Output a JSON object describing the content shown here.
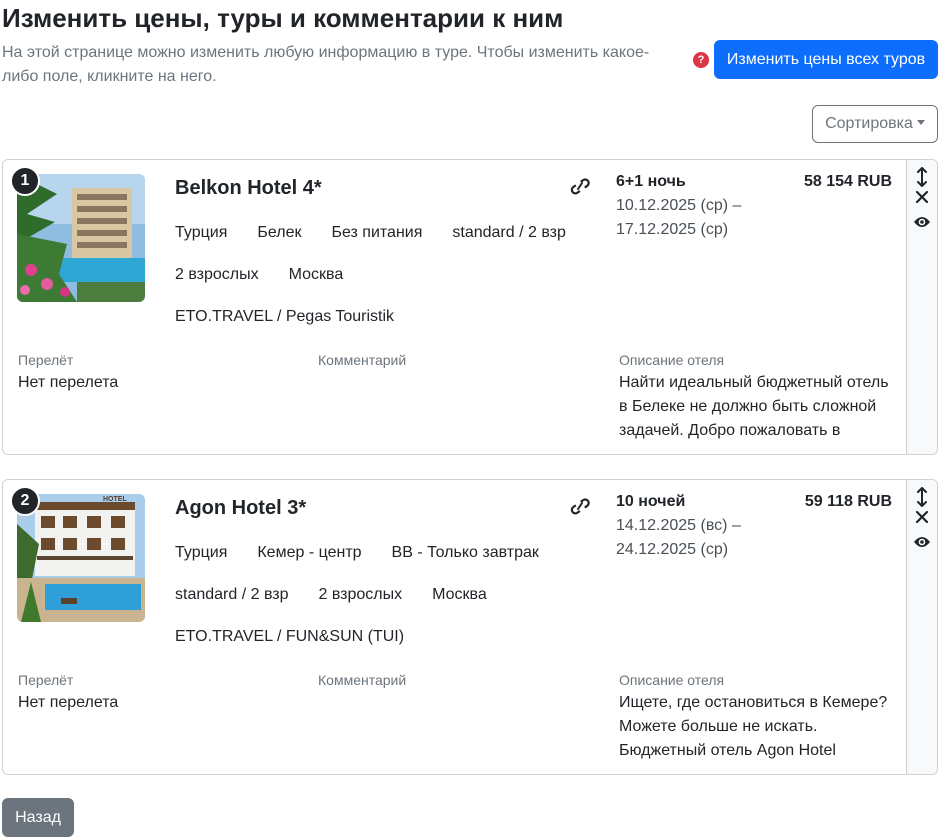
{
  "header": {
    "title": "Изменить цены, туры и комментарии к ним",
    "description": "На этой странице можно изменить любую информацию в туре. Чтобы изменить какое-либо поле, кликните на него.",
    "help_icon": "?",
    "change_all_label": "Изменить цены всех туров",
    "sort_label": "Сортировка"
  },
  "tours": [
    {
      "number": "1",
      "hotel": "Belkon Hotel 4*",
      "tags_row1": [
        "Турция",
        "Белек",
        "Без питания",
        "standard / 2 взр"
      ],
      "tags_row2": [
        "2 взрослых",
        "Москва"
      ],
      "operator": "ETO.TRAVEL / Pegas Touristik",
      "nights": "6+1 ночь",
      "dates": "10.12.2025 (ср) – 17.12.2025 (ср)",
      "price": "58 154 RUB",
      "flight_label": "Перелёт",
      "flight_value": "Нет перелета",
      "comment_label": "Комментарий",
      "description_label": "Описание отеля",
      "description": "Найти идеальный бюджетный отель в Белеке не должно быть сложной задачей. Добро пожаловать в"
    },
    {
      "number": "2",
      "hotel": "Agon Hotel 3*",
      "tags_row1": [
        "Турция",
        "Кемер - центр",
        "BB - Только завтрак"
      ],
      "tags_row2": [
        "standard / 2 взр",
        "2 взрослых",
        "Москва"
      ],
      "operator": "ETO.TRAVEL / FUN&SUN (TUI)",
      "nights": "10 ночей",
      "dates": "14.12.2025 (вс) – 24.12.2025 (ср)",
      "price": "59 118 RUB",
      "flight_label": "Перелёт",
      "flight_value": "Нет перелета",
      "comment_label": "Комментарий",
      "description_label": "Описание отеля",
      "description": "Ищете, где остановиться в Кемере? Можете больше не искать. Бюджетный отель Agon Hotel",
      "photo_sign": "HOTEL"
    }
  ],
  "footer": {
    "back_label": "Назад"
  },
  "colors": {
    "primary": "#0d6efd",
    "secondary": "#6c757d",
    "danger": "#dc3545"
  }
}
